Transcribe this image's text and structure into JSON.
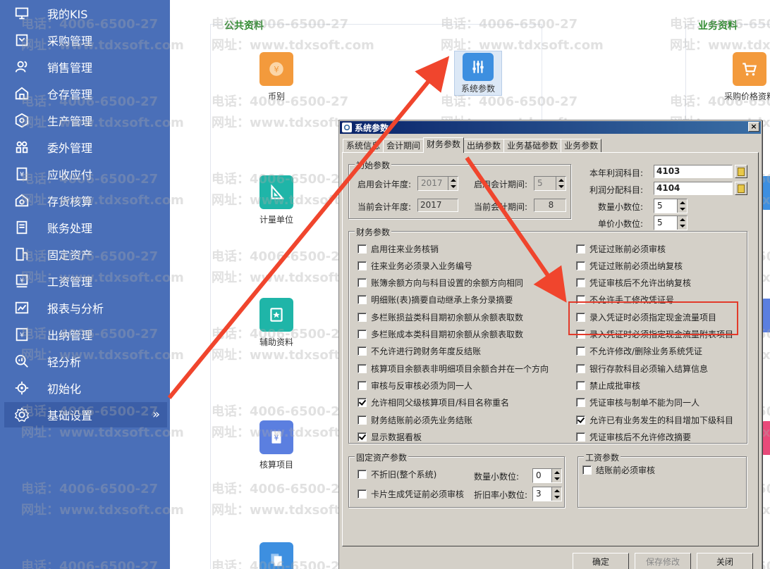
{
  "sidebar": {
    "items": [
      {
        "label": "我的KIS",
        "icon": "monitor-icon"
      },
      {
        "label": "采购管理",
        "icon": "purchase-icon"
      },
      {
        "label": "销售管理",
        "icon": "users-icon"
      },
      {
        "label": "仓存管理",
        "icon": "warehouse-icon"
      },
      {
        "label": "生产管理",
        "icon": "production-icon"
      },
      {
        "label": "委外管理",
        "icon": "outsource-icon"
      },
      {
        "label": "应收应付",
        "icon": "receivable-icon"
      },
      {
        "label": "存货核算",
        "icon": "inventory-icon"
      },
      {
        "label": "账务处理",
        "icon": "ledger-icon"
      },
      {
        "label": "固定资产",
        "icon": "asset-icon"
      },
      {
        "label": "工资管理",
        "icon": "salary-icon"
      },
      {
        "label": "报表与分析",
        "icon": "chart-icon"
      },
      {
        "label": "出纳管理",
        "icon": "cashier-icon"
      },
      {
        "label": "轻分析",
        "icon": "analysis-icon"
      },
      {
        "label": "初始化",
        "icon": "init-icon"
      },
      {
        "label": "基础设置",
        "icon": "gear-icon",
        "chevron": "»"
      }
    ]
  },
  "panels": {
    "public_title": "公共资料",
    "business_title": "业务资料",
    "tiles": {
      "currency": "币别",
      "system_params": "系统参数",
      "unit": "计量单位",
      "auxiliary": "辅助资料",
      "accounting_item": "核算项目",
      "purchase_price": "采购价格资料"
    }
  },
  "watermark": {
    "phone": "电话：4006-6500-27",
    "site": "网址：www.tdxsoft.com"
  },
  "dialog": {
    "title": "系统参数",
    "close": "×",
    "tabs": [
      "系统信息",
      "会计期间",
      "财务参数",
      "出纳参数",
      "业务基础参数",
      "业务参数"
    ],
    "init_group": {
      "title": "初始参数",
      "start_year_label": "启用会计年度:",
      "start_year": "2017",
      "start_period_label": "启用会计期间:",
      "start_period": "5",
      "cur_year_label": "当前会计年度:",
      "cur_year": "2017",
      "cur_period_label": "当前会计期间:",
      "cur_period": "8"
    },
    "right_top": {
      "profit_label": "本年利润科目:",
      "profit_value": "4103",
      "dist_label": "利润分配科目:",
      "dist_value": "4104",
      "qty_decimal_label": "数量小数位:",
      "qty_decimal": "5",
      "price_decimal_label": "单价小数位:",
      "price_decimal": "5"
    },
    "finance_group": {
      "title": "财务参数",
      "left": [
        {
          "label": "启用往来业务核销",
          "checked": false
        },
        {
          "label": "往来业务必须录入业务编号",
          "checked": false
        },
        {
          "label": "账簿余额方向与科目设置的余额方向相同",
          "checked": false
        },
        {
          "label": "明细账(表)摘要自动继承上条分录摘要",
          "checked": false
        },
        {
          "label": "多栏账损益类科目期初余额从余额表取数",
          "checked": false
        },
        {
          "label": "多栏账成本类科目期初余额从余额表取数",
          "checked": false
        },
        {
          "label": "不允许进行跨财务年度反结账",
          "checked": false
        },
        {
          "label": "核算项目余额表非明细项目余额合并在一个方向",
          "checked": false
        },
        {
          "label": "审核与反审核必须为同一人",
          "checked": false
        },
        {
          "label": "允许相同父级核算项目/科目名称重名",
          "checked": true
        },
        {
          "label": "财务结账前必须先业务结账",
          "checked": false
        },
        {
          "label": "显示数据看板",
          "checked": true
        }
      ],
      "right": [
        {
          "label": "凭证过账前必须审核",
          "checked": false
        },
        {
          "label": "凭证过账前必须出纳复核",
          "checked": false
        },
        {
          "label": "凭证审核后不允许出纳复核",
          "checked": false
        },
        {
          "label": "不允许手工修改凭证号",
          "checked": false
        },
        {
          "label": "录入凭证时必须指定现金流量项目",
          "checked": false
        },
        {
          "label": "录入凭证时必须指定现金流量附表项目",
          "checked": false
        },
        {
          "label": "不允许修改/删除业务系统凭证",
          "checked": false
        },
        {
          "label": "银行存款科目必须输入结算信息",
          "checked": false
        },
        {
          "label": "禁止成批审核",
          "checked": false
        },
        {
          "label": "凭证审核与制单不能为同一人",
          "checked": false
        },
        {
          "label": "允许已有业务发生的科目增加下级科目",
          "checked": true
        },
        {
          "label": "凭证审核后不允许修改摘要",
          "checked": false
        }
      ]
    },
    "asset_group": {
      "title": "固定资产参数",
      "no_depr_label": "不折旧(整个系统)",
      "no_depr_checked": false,
      "card_audit_label": "卡片生成凭证前必须审核",
      "card_audit_checked": false,
      "qty_decimal_label": "数量小数位:",
      "qty_decimal": "0",
      "depr_decimal_label": "折旧率小数位:",
      "depr_decimal": "3"
    },
    "salary_group": {
      "title": "工资参数",
      "audit_label": "结账前必须审核",
      "audit_checked": false
    },
    "buttons": {
      "ok": "确定",
      "save": "保存修改",
      "close": "关闭"
    }
  },
  "colors": {
    "sidebar": "#4a6fb8",
    "accent_red": "#e23a2a",
    "title_green": "#2e8a2e"
  }
}
